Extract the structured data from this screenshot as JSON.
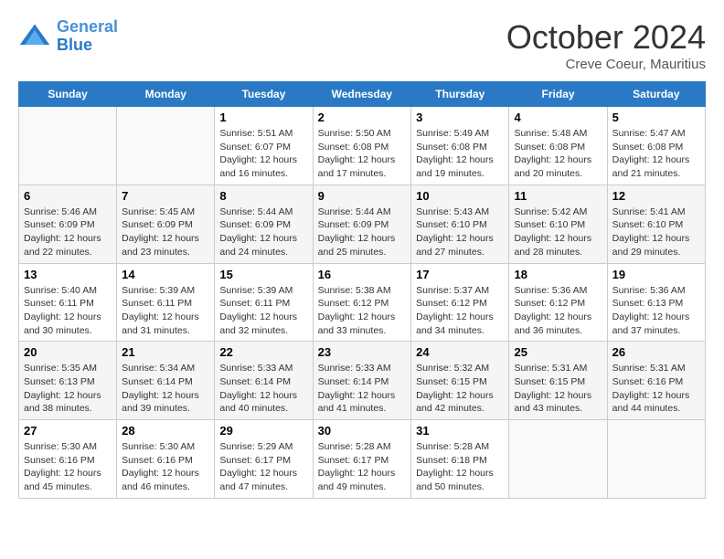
{
  "header": {
    "logo_line1": "General",
    "logo_line2": "Blue",
    "month": "October 2024",
    "location": "Creve Coeur, Mauritius"
  },
  "days_of_week": [
    "Sunday",
    "Monday",
    "Tuesday",
    "Wednesday",
    "Thursday",
    "Friday",
    "Saturday"
  ],
  "weeks": [
    [
      {
        "day": "",
        "empty": true
      },
      {
        "day": "",
        "empty": true
      },
      {
        "day": "1",
        "sunrise": "5:51 AM",
        "sunset": "6:07 PM",
        "daylight": "12 hours and 16 minutes."
      },
      {
        "day": "2",
        "sunrise": "5:50 AM",
        "sunset": "6:08 PM",
        "daylight": "12 hours and 17 minutes."
      },
      {
        "day": "3",
        "sunrise": "5:49 AM",
        "sunset": "6:08 PM",
        "daylight": "12 hours and 19 minutes."
      },
      {
        "day": "4",
        "sunrise": "5:48 AM",
        "sunset": "6:08 PM",
        "daylight": "12 hours and 20 minutes."
      },
      {
        "day": "5",
        "sunrise": "5:47 AM",
        "sunset": "6:08 PM",
        "daylight": "12 hours and 21 minutes."
      }
    ],
    [
      {
        "day": "6",
        "sunrise": "5:46 AM",
        "sunset": "6:09 PM",
        "daylight": "12 hours and 22 minutes."
      },
      {
        "day": "7",
        "sunrise": "5:45 AM",
        "sunset": "6:09 PM",
        "daylight": "12 hours and 23 minutes."
      },
      {
        "day": "8",
        "sunrise": "5:44 AM",
        "sunset": "6:09 PM",
        "daylight": "12 hours and 24 minutes."
      },
      {
        "day": "9",
        "sunrise": "5:44 AM",
        "sunset": "6:09 PM",
        "daylight": "12 hours and 25 minutes."
      },
      {
        "day": "10",
        "sunrise": "5:43 AM",
        "sunset": "6:10 PM",
        "daylight": "12 hours and 27 minutes."
      },
      {
        "day": "11",
        "sunrise": "5:42 AM",
        "sunset": "6:10 PM",
        "daylight": "12 hours and 28 minutes."
      },
      {
        "day": "12",
        "sunrise": "5:41 AM",
        "sunset": "6:10 PM",
        "daylight": "12 hours and 29 minutes."
      }
    ],
    [
      {
        "day": "13",
        "sunrise": "5:40 AM",
        "sunset": "6:11 PM",
        "daylight": "12 hours and 30 minutes."
      },
      {
        "day": "14",
        "sunrise": "5:39 AM",
        "sunset": "6:11 PM",
        "daylight": "12 hours and 31 minutes."
      },
      {
        "day": "15",
        "sunrise": "5:39 AM",
        "sunset": "6:11 PM",
        "daylight": "12 hours and 32 minutes."
      },
      {
        "day": "16",
        "sunrise": "5:38 AM",
        "sunset": "6:12 PM",
        "daylight": "12 hours and 33 minutes."
      },
      {
        "day": "17",
        "sunrise": "5:37 AM",
        "sunset": "6:12 PM",
        "daylight": "12 hours and 34 minutes."
      },
      {
        "day": "18",
        "sunrise": "5:36 AM",
        "sunset": "6:12 PM",
        "daylight": "12 hours and 36 minutes."
      },
      {
        "day": "19",
        "sunrise": "5:36 AM",
        "sunset": "6:13 PM",
        "daylight": "12 hours and 37 minutes."
      }
    ],
    [
      {
        "day": "20",
        "sunrise": "5:35 AM",
        "sunset": "6:13 PM",
        "daylight": "12 hours and 38 minutes."
      },
      {
        "day": "21",
        "sunrise": "5:34 AM",
        "sunset": "6:14 PM",
        "daylight": "12 hours and 39 minutes."
      },
      {
        "day": "22",
        "sunrise": "5:33 AM",
        "sunset": "6:14 PM",
        "daylight": "12 hours and 40 minutes."
      },
      {
        "day": "23",
        "sunrise": "5:33 AM",
        "sunset": "6:14 PM",
        "daylight": "12 hours and 41 minutes."
      },
      {
        "day": "24",
        "sunrise": "5:32 AM",
        "sunset": "6:15 PM",
        "daylight": "12 hours and 42 minutes."
      },
      {
        "day": "25",
        "sunrise": "5:31 AM",
        "sunset": "6:15 PM",
        "daylight": "12 hours and 43 minutes."
      },
      {
        "day": "26",
        "sunrise": "5:31 AM",
        "sunset": "6:16 PM",
        "daylight": "12 hours and 44 minutes."
      }
    ],
    [
      {
        "day": "27",
        "sunrise": "5:30 AM",
        "sunset": "6:16 PM",
        "daylight": "12 hours and 45 minutes."
      },
      {
        "day": "28",
        "sunrise": "5:30 AM",
        "sunset": "6:16 PM",
        "daylight": "12 hours and 46 minutes."
      },
      {
        "day": "29",
        "sunrise": "5:29 AM",
        "sunset": "6:17 PM",
        "daylight": "12 hours and 47 minutes."
      },
      {
        "day": "30",
        "sunrise": "5:28 AM",
        "sunset": "6:17 PM",
        "daylight": "12 hours and 49 minutes."
      },
      {
        "day": "31",
        "sunrise": "5:28 AM",
        "sunset": "6:18 PM",
        "daylight": "12 hours and 50 minutes."
      },
      {
        "day": "",
        "empty": true
      },
      {
        "day": "",
        "empty": true
      }
    ]
  ],
  "labels": {
    "sunrise": "Sunrise:",
    "sunset": "Sunset:",
    "daylight": "Daylight:"
  }
}
